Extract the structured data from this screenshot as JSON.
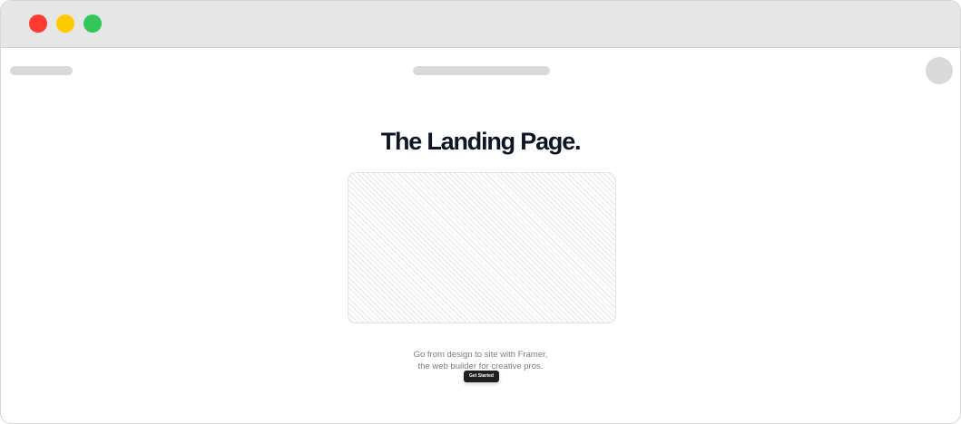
{
  "colors": {
    "close_dot": "#fe3b30",
    "minimize_dot": "#fecb00",
    "zoom_dot": "#33c759",
    "headline": "#0d1526",
    "button_bg": "#1f1f1f"
  },
  "hero": {
    "title": "The Landing Page.",
    "description_line1": "Go from design to site with Framer,",
    "description_line2": "the web builder for creative pros.",
    "cta_label": "Get Started"
  }
}
